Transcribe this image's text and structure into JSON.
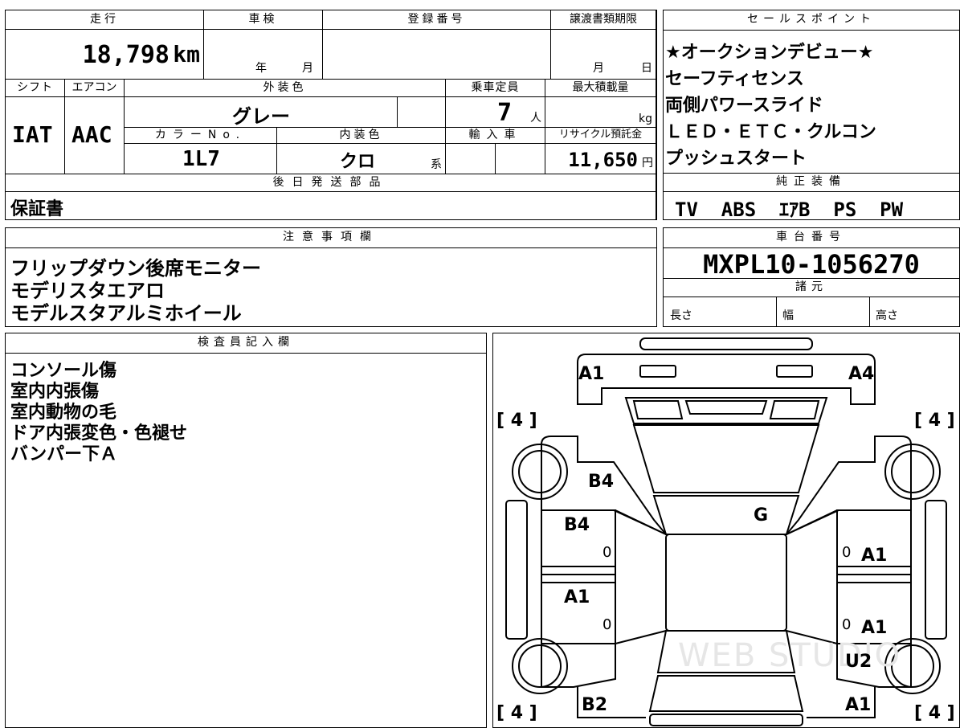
{
  "top_sheet": {
    "mileage_label": "走行",
    "mileage_value": "18,798",
    "mileage_unit": "km",
    "inspection_label": "車検",
    "inspection_year": "年",
    "inspection_month": "月",
    "registration_label": "登録番号",
    "transfer_label": "譲渡書類期限",
    "transfer_month": "月",
    "transfer_day": "日",
    "shift_label": "シフト",
    "shift_value": "IAT",
    "ac_label": "エアコン",
    "ac_value": "AAC",
    "exterior_label": "外装色",
    "exterior_value": "グレー",
    "capacity_label": "乗車定員",
    "capacity_value": "7",
    "capacity_unit": "人",
    "maxload_label": "最大積載量",
    "maxload_unit": "kg",
    "colorno_label": "カラーNo.",
    "colorno_value": "1L7",
    "interior_label": "内装色",
    "interior_value": "クロ",
    "interior_suffix": "系",
    "import_label": "輸入車",
    "recycle_label": "リサイクル預託金",
    "recycle_value": "11,650",
    "recycle_unit": "円",
    "later_parts_label": "後日発送部品",
    "later_parts_value": "保証書"
  },
  "sales_points": {
    "label": "セールスポイント",
    "lines": [
      "★オークションデビュー★",
      "セーフティセンス",
      "両側パワースライド",
      "ＬＥＤ・ＥＴＣ・クルコン",
      "プッシュスタート"
    ]
  },
  "equipment": {
    "label": "純正装備",
    "value": "TV  ABS  ｴｱB  PS  PW"
  },
  "notes": {
    "label": "注意事項欄",
    "lines": [
      "フリップダウン後席モニター",
      "モデリスタエアロ",
      "モデルスタアルミホイール"
    ]
  },
  "chassis": {
    "label": "車台番号",
    "value": "MXPL10-1056270",
    "spec_label": "諸元",
    "length_label": "長さ",
    "width_label": "幅",
    "height_label": "高さ"
  },
  "inspector": {
    "label": "検査員記入欄",
    "lines": [
      "コンソール傷",
      "室内内張傷",
      "室内動物の毛",
      "ドア内張変色・色褪せ",
      "バンパー下Ａ"
    ]
  },
  "diagram": {
    "tire_left_top": "[ 4 ]",
    "tire_right_top": "[ 4 ]",
    "tire_left_bottom": "[ 4 ]",
    "tire_right_bottom": "[ 4 ]",
    "front_left": "A1",
    "front_right": "A4",
    "fender_left": "B4",
    "door_front_left": "B4",
    "door_rear_left": "A1",
    "windshield": "G",
    "door_front_right": "A1",
    "door_rear_right": "A1",
    "rear_fender_right": "U2",
    "rear_left": "B2",
    "rear_right": "A1",
    "mark_zero_1": "0",
    "mark_zero_2": "0",
    "mark_zero_3": "0",
    "mark_zero_4": "0",
    "watermark": "WEB STUDIO"
  }
}
